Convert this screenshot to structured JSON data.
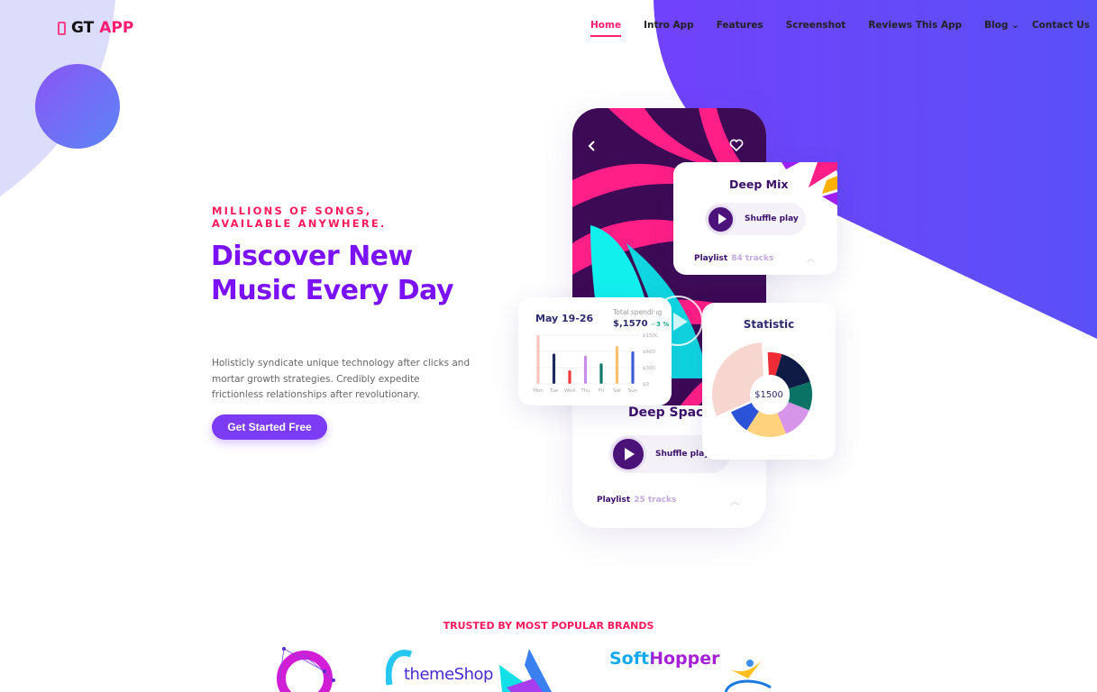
{
  "brand": {
    "prefix": "GT",
    "suffix": "APP"
  },
  "nav": [
    {
      "label": "Home",
      "active": true
    },
    {
      "label": "Intro App"
    },
    {
      "label": "Features"
    },
    {
      "label": "Screenshot"
    },
    {
      "label": "Reviews This App"
    },
    {
      "label": "Blog ⌄"
    },
    {
      "label": "Contact Us"
    }
  ],
  "hero": {
    "kicker": "MILLIONS OF SONGS, AVAILABLE ANYWHERE.",
    "title": "Discover New Music Every Day",
    "description": "Holisticly syndicate unique technology after clicks and mortar growth strategies. Credibly expedite frictionless relationships after revolutionary.",
    "cta": "Get Started Free"
  },
  "mockup": {
    "deep_mix": {
      "title": "Deep Mix",
      "shuffle": "Shuffle play",
      "playlist": "Playlist",
      "tracks": "84 tracks"
    },
    "deep_space": {
      "title": "Deep Space",
      "shuffle": "Shuffle play",
      "playlist": "Playlist",
      "tracks": "25 tracks"
    },
    "spending": {
      "date": "May 19-26",
      "label": "Total spending",
      "amount": "$,1570",
      "change": "+3 %",
      "yticks": [
        "$1500",
        "$600",
        "$300",
        "$0"
      ],
      "days": [
        "Mon",
        "Tue",
        "Wed",
        "Thu",
        "Fri",
        "Sat",
        "Sun"
      ],
      "values": [
        1500,
        560,
        250,
        520,
        380,
        900,
        600
      ],
      "colors": [
        "#f7c3bd",
        "#1d2a5e",
        "#f23b3b",
        "#c78be8",
        "#0f7a6a",
        "#ffc06b",
        "#3f5cd6"
      ]
    },
    "statistic": {
      "title": "Statistic",
      "center": "$1500",
      "segments": [
        {
          "value": 6,
          "color": "#ef2b36"
        },
        {
          "value": 17,
          "color": "#0f1a45"
        },
        {
          "value": 12,
          "color": "#0a7366"
        },
        {
          "value": 14,
          "color": "#d795ea"
        },
        {
          "value": 17,
          "color": "#ffd27d"
        },
        {
          "value": 10,
          "color": "#2b53d8"
        },
        {
          "value": 34,
          "color": "#f8d6d0",
          "exploded": true
        }
      ]
    }
  },
  "brands": {
    "heading": "TRUSTED BY MOST POPULAR BRANDS",
    "items": [
      "themeShop",
      "SoftHopper"
    ]
  },
  "colors": {
    "accent": "#ff1a72",
    "primary": "#7a12f5",
    "purple_bg": "#6a48fa",
    "lavender": "#dcdcfb"
  }
}
